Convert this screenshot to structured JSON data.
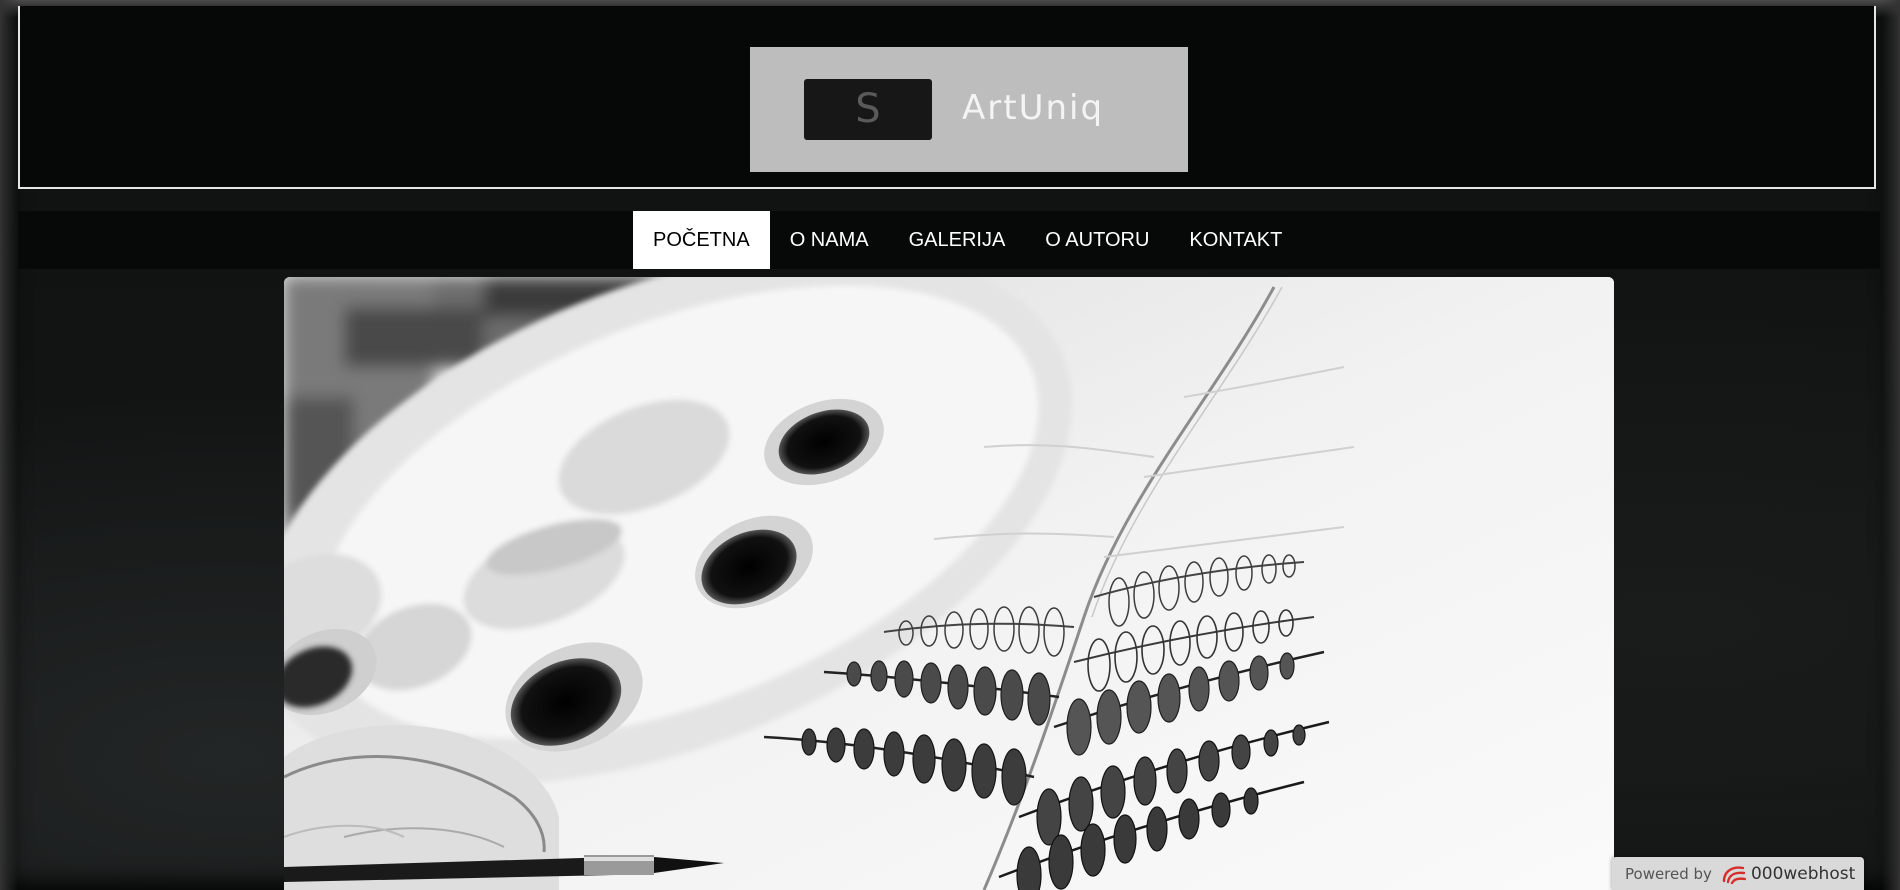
{
  "header": {
    "logo": {
      "mark": "S",
      "name": "ArtUniq"
    }
  },
  "nav": {
    "items": [
      {
        "label": "POČETNA",
        "active": true
      },
      {
        "label": "O NAMA",
        "active": false
      },
      {
        "label": "GALERIJA",
        "active": false
      },
      {
        "label": "O AUTORU",
        "active": false
      },
      {
        "label": "KONTAKT",
        "active": false
      }
    ]
  },
  "hero": {
    "image": "black-and-white photo of a hand painting a fern with a paint palette"
  },
  "badge": {
    "prefix": "Powered by",
    "brand": "000webhost",
    "icon": "000webhost-swirl-icon"
  },
  "colors": {
    "header_bg": "#060707",
    "logo_bg": "#bdbdbd",
    "nav_active_bg": "#ffffff",
    "badge_bg": "#d9d9d9",
    "badge_icon": "#d62d2d"
  }
}
